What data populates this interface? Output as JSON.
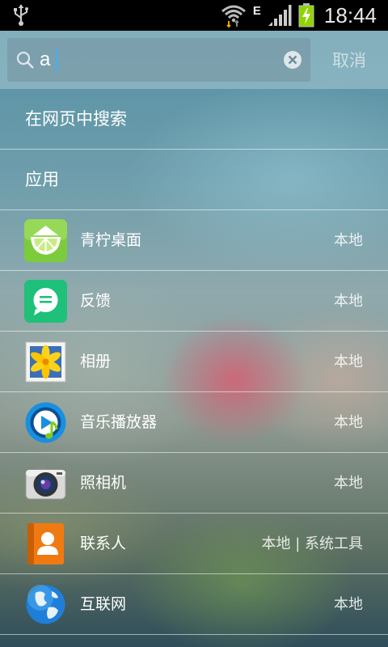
{
  "status_bar": {
    "network_type": "E",
    "time": "18:44"
  },
  "search": {
    "query": "a",
    "cancel_label": "取消"
  },
  "web_search_label": "在网页中搜索",
  "section_title": "应用",
  "apps": [
    {
      "name": "青柠桌面",
      "tag": "本地",
      "icon": "lime-launcher-icon"
    },
    {
      "name": "反馈",
      "tag": "本地",
      "icon": "feedback-icon"
    },
    {
      "name": "相册",
      "tag": "本地",
      "icon": "gallery-icon"
    },
    {
      "name": "音乐播放器",
      "tag": "本地",
      "icon": "music-player-icon"
    },
    {
      "name": "照相机",
      "tag": "本地",
      "icon": "camera-icon"
    },
    {
      "name": "联系人",
      "tag": "本地 | 系统工具",
      "icon": "contacts-icon"
    },
    {
      "name": "互联网",
      "tag": "本地",
      "icon": "browser-icon"
    }
  ],
  "colors": {
    "status_bar": "#000000",
    "caret": "#3fb0ff",
    "battery_charge": "#8fd400"
  }
}
